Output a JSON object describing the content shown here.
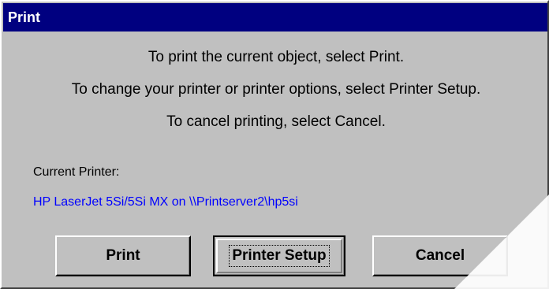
{
  "window": {
    "title": "Print"
  },
  "message": {
    "line1": "To print the current object, select Print.",
    "line2": "To change your printer or printer options, select Printer Setup.",
    "line3": "To cancel printing, select Cancel."
  },
  "printer": {
    "label": "Current Printer:",
    "name": "HP LaserJet 5Si/5Si MX on \\\\Printserver2\\hp5si"
  },
  "buttons": {
    "print": "Print",
    "setup": "Printer Setup",
    "cancel": "Cancel"
  },
  "colors": {
    "title_bar": "#000080",
    "printer_name": "#0000ff",
    "face": "#c0c0c0"
  }
}
